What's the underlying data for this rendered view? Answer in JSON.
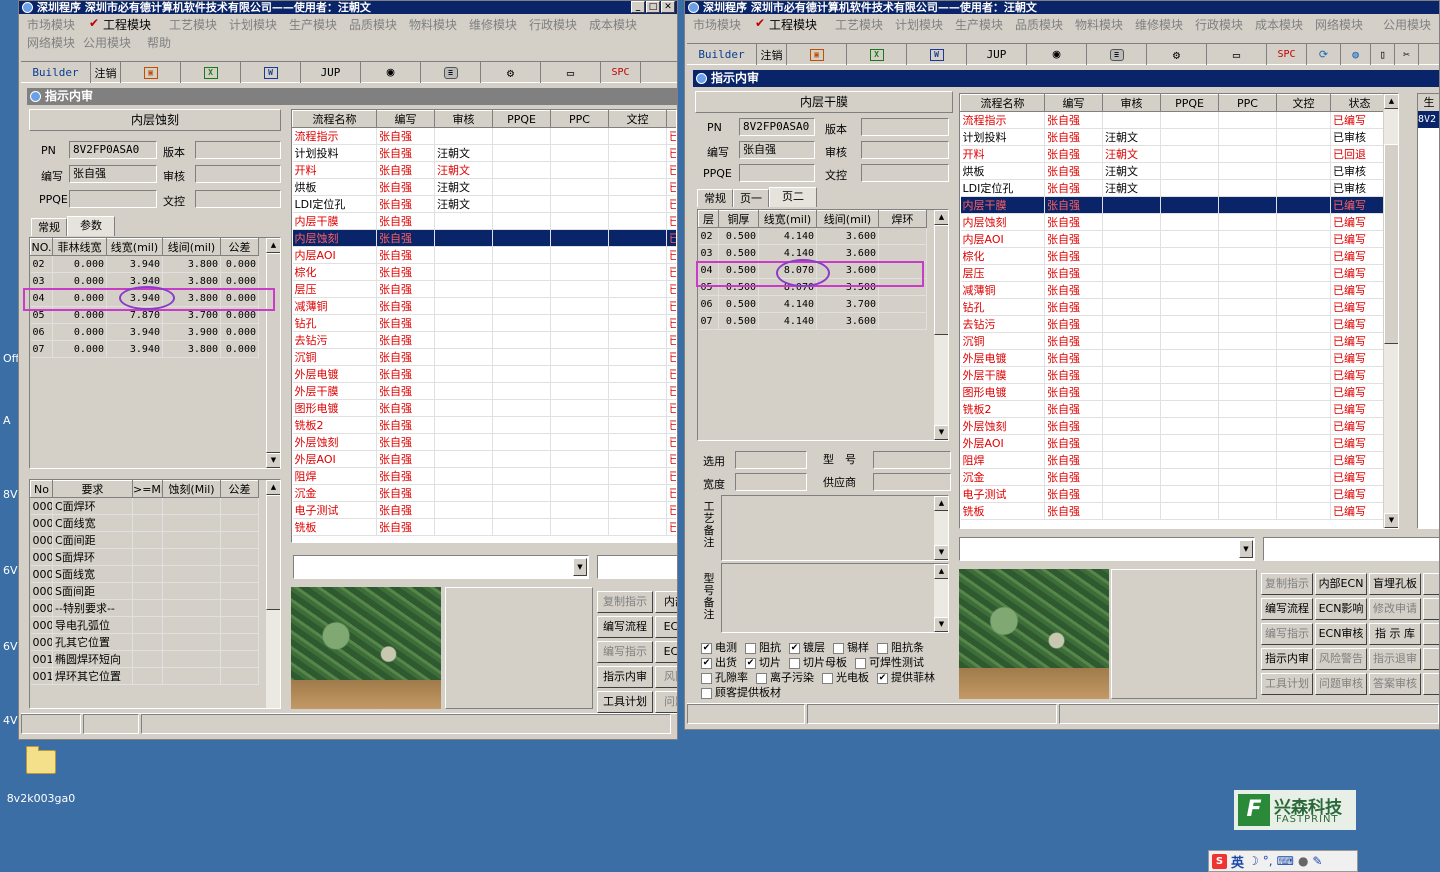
{
  "left_window": {
    "title": "深圳程序    深圳市必有德计算机软件技术有限公司——使用者：汪朝文",
    "menu_row1": [
      "市场模块",
      "工程模块",
      "工艺模块",
      "计划模块",
      "生产模块",
      "品质模块",
      "物料模块",
      "维修模块",
      "行政模块",
      "成本模块"
    ],
    "menu_row2": [
      "网络模块",
      "公用模块",
      "帮助"
    ],
    "toolbar": {
      "builder": "Builder",
      "logout": "注销",
      "jup": "JUP",
      "spc": "SPC"
    },
    "panel_title": "指示内审",
    "process_name": "内层蚀刻",
    "labels": {
      "pn": "PN",
      "version": "版本",
      "author": "编写",
      "review": "审核",
      "ppqe": "PPQE",
      "doc_control": "文控"
    },
    "fields": {
      "pn": "8V2FP0ASA0",
      "author": "张自强"
    },
    "tabs": [
      "常规",
      "参数"
    ],
    "param_headers": [
      "NO.",
      "菲林线宽",
      "线宽(mil)",
      "线间(mil)",
      "公差"
    ],
    "param_rows": [
      [
        "02",
        "0.000",
        "3.940",
        "3.800",
        "0.000"
      ],
      [
        "03",
        "0.000",
        "3.940",
        "3.800",
        "0.000"
      ],
      [
        "04",
        "0.000",
        "3.940",
        "3.800",
        "0.000"
      ],
      [
        "05",
        "0.000",
        "7.870",
        "3.700",
        "0.000"
      ],
      [
        "06",
        "0.000",
        "3.940",
        "3.900",
        "0.000"
      ],
      [
        "07",
        "0.000",
        "3.940",
        "3.800",
        "0.000"
      ]
    ],
    "req_headers": [
      "No",
      "要求",
      ">=Mil",
      "蚀刻(Mil)",
      "公差"
    ],
    "req_rows": [
      [
        "000",
        "C面焊环"
      ],
      [
        "000",
        "C面线宽"
      ],
      [
        "000",
        "C面间距"
      ],
      [
        "000",
        "S面焊环"
      ],
      [
        "000",
        "S面线宽"
      ],
      [
        "000",
        "S面间距"
      ],
      [
        "000",
        "--特别要求--"
      ],
      [
        "000",
        "导电孔弧位"
      ],
      [
        "000",
        "孔其它位置"
      ],
      [
        "001",
        "椭圆焊环短向"
      ],
      [
        "001",
        "焊环其它位置"
      ]
    ],
    "flow_headers": [
      "流程名称",
      "编写",
      "审核",
      "PPQE",
      "PPC",
      "文控"
    ],
    "flow_rows": [
      {
        "name": "流程指示",
        "author": "张自强",
        "review": "",
        "red": true
      },
      {
        "name": "计划投料",
        "author": "张自强",
        "review": "汪朝文",
        "red": false
      },
      {
        "name": "开料",
        "author": "张自强",
        "review": "汪朝文",
        "red": true
      },
      {
        "name": "烘板",
        "author": "张自强",
        "review": "汪朝文",
        "red": false
      },
      {
        "name": "LDI定位孔",
        "author": "张自强",
        "review": "汪朝文",
        "red": false
      },
      {
        "name": "内层干膜",
        "author": "张自强",
        "review": "",
        "red": true
      },
      {
        "name": "内层蚀刻",
        "author": "张自强",
        "review": "",
        "red": true,
        "selected": true
      },
      {
        "name": "内层AOI",
        "author": "张自强",
        "review": "",
        "red": true
      },
      {
        "name": "棕化",
        "author": "张自强",
        "review": "",
        "red": true
      },
      {
        "name": "层压",
        "author": "张自强",
        "review": "",
        "red": true
      },
      {
        "name": "减薄铜",
        "author": "张自强",
        "review": "",
        "red": true
      },
      {
        "name": "钻孔",
        "author": "张自强",
        "review": "",
        "red": true
      },
      {
        "name": "去钻污",
        "author": "张自强",
        "review": "",
        "red": true
      },
      {
        "name": "沉铜",
        "author": "张自强",
        "review": "",
        "red": true
      },
      {
        "name": "外层电镀",
        "author": "张自强",
        "review": "",
        "red": true
      },
      {
        "name": "外层干膜",
        "author": "张自强",
        "review": "",
        "red": true
      },
      {
        "name": "图形电镀",
        "author": "张自强",
        "review": "",
        "red": true
      },
      {
        "name": "铣板2",
        "author": "张自强",
        "review": "",
        "red": true
      },
      {
        "name": "外层蚀刻",
        "author": "张自强",
        "review": "",
        "red": true
      },
      {
        "name": "外层AOI",
        "author": "张自强",
        "review": "",
        "red": true
      },
      {
        "name": "阻焊",
        "author": "张自强",
        "review": "",
        "red": true
      },
      {
        "name": "沉金",
        "author": "张自强",
        "review": "",
        "red": true
      },
      {
        "name": "电子测试",
        "author": "张自强",
        "review": "",
        "red": true
      },
      {
        "name": "铣板",
        "author": "张自强",
        "review": "",
        "red": true
      }
    ],
    "buttons": [
      [
        "复制指示",
        "内部"
      ],
      [
        "编写流程",
        "ECN"
      ],
      [
        "编写指示",
        "ECN"
      ],
      [
        "指示内审",
        "风险"
      ],
      [
        "工具计划",
        "问题"
      ]
    ]
  },
  "right_window": {
    "title": "深圳程序    深圳市必有德计算机软件技术有限公司——使用者：汪朝文",
    "menu_row1": [
      "市场模块",
      "工程模块",
      "工艺模块",
      "计划模块",
      "生产模块",
      "品质模块",
      "物料模块",
      "维修模块",
      "行政模块",
      "成本模块",
      "网络模块",
      "公用模块"
    ],
    "toolbar": {
      "builder": "Builder",
      "logout": "注销",
      "jup": "JUP",
      "spc": "SPC"
    },
    "panel_title": "指示内审",
    "process_name": "内层干膜",
    "labels": {
      "pn": "PN",
      "version": "版本",
      "author": "编写",
      "review": "审核",
      "ppqe": "PPQE",
      "doc_control": "文控"
    },
    "fields": {
      "pn": "8V2FP0ASA0",
      "author": "张自强"
    },
    "tabs": [
      "常规",
      "页一",
      "页二"
    ],
    "param_headers": [
      "层",
      "铜厚",
      "线宽(mil)",
      "线间(mil)",
      "焊环"
    ],
    "param_rows": [
      [
        "02",
        "0.500",
        "4.140",
        "3.600",
        ""
      ],
      [
        "03",
        "0.500",
        "4.140",
        "3.600",
        ""
      ],
      [
        "04",
        "0.500",
        "8.070",
        "3.600",
        ""
      ],
      [
        "05",
        "0.500",
        "8.070",
        "3.500",
        ""
      ],
      [
        "06",
        "0.500",
        "4.140",
        "3.700",
        ""
      ],
      [
        "07",
        "0.500",
        "4.140",
        "3.600",
        ""
      ]
    ],
    "labels2": {
      "choose": "选用",
      "model": "型　号",
      "width": "宽度",
      "supplier": "供应商",
      "process_note": "工艺备注",
      "model_note": "型号备注"
    },
    "checkboxes": [
      {
        "label": "电测",
        "checked": true
      },
      {
        "label": "阻抗",
        "checked": false
      },
      {
        "label": "镀层",
        "checked": true
      },
      {
        "label": "锡样",
        "checked": false
      },
      {
        "label": "阻抗条",
        "checked": false
      },
      {
        "label": "出货",
        "checked": true
      },
      {
        "label": "切片",
        "checked": true
      },
      {
        "label": "切片母板",
        "checked": false
      },
      {
        "label": "可焊性测试",
        "checked": false
      },
      {
        "label": "孔隙率",
        "checked": false
      },
      {
        "label": "离子污染",
        "checked": false
      },
      {
        "label": "光电板",
        "checked": false
      },
      {
        "label": "提供菲林",
        "checked": true
      },
      {
        "label": "顾客提供板材",
        "checked": false
      }
    ],
    "flow_headers": [
      "流程名称",
      "编写",
      "审核",
      "PPQE",
      "PPC",
      "文控",
      "状态"
    ],
    "flow_rows": [
      {
        "name": "流程指示",
        "author": "张自强",
        "review": "",
        "status": "已编写",
        "red": true,
        "status_red": true
      },
      {
        "name": "计划投料",
        "author": "张自强",
        "review": "汪朝文",
        "status": "已审核",
        "red": false,
        "status_red": false
      },
      {
        "name": "开料",
        "author": "张自强",
        "review": "汪朝文",
        "status": "已回退",
        "red": true,
        "status_red": true
      },
      {
        "name": "烘板",
        "author": "张自强",
        "review": "汪朝文",
        "status": "已审核",
        "red": false,
        "status_red": false
      },
      {
        "name": "LDI定位孔",
        "author": "张自强",
        "review": "汪朝文",
        "status": "已审核",
        "red": false,
        "status_red": false
      },
      {
        "name": "内层干膜",
        "author": "张自强",
        "review": "",
        "status": "已编写",
        "red": true,
        "status_red": true,
        "selected": true
      },
      {
        "name": "内层蚀刻",
        "author": "张自强",
        "review": "",
        "status": "已编写",
        "red": true,
        "status_red": true
      },
      {
        "name": "内层AOI",
        "author": "张自强",
        "review": "",
        "status": "已编写",
        "red": true,
        "status_red": true
      },
      {
        "name": "棕化",
        "author": "张自强",
        "review": "",
        "status": "已编写",
        "red": true,
        "status_red": true
      },
      {
        "name": "层压",
        "author": "张自强",
        "review": "",
        "status": "已编写",
        "red": true,
        "status_red": true
      },
      {
        "name": "减薄铜",
        "author": "张自强",
        "review": "",
        "status": "已编写",
        "red": true,
        "status_red": true
      },
      {
        "name": "钻孔",
        "author": "张自强",
        "review": "",
        "status": "已编写",
        "red": true,
        "status_red": true
      },
      {
        "name": "去钻污",
        "author": "张自强",
        "review": "",
        "status": "已编写",
        "red": true,
        "status_red": true
      },
      {
        "name": "沉铜",
        "author": "张自强",
        "review": "",
        "status": "已编写",
        "red": true,
        "status_red": true
      },
      {
        "name": "外层电镀",
        "author": "张自强",
        "review": "",
        "status": "已编写",
        "red": true,
        "status_red": true
      },
      {
        "name": "外层干膜",
        "author": "张自强",
        "review": "",
        "status": "已编写",
        "red": true,
        "status_red": true
      },
      {
        "name": "图形电镀",
        "author": "张自强",
        "review": "",
        "status": "已编写",
        "red": true,
        "status_red": true
      },
      {
        "name": "铣板2",
        "author": "张自强",
        "review": "",
        "status": "已编写",
        "red": true,
        "status_red": true
      },
      {
        "name": "外层蚀刻",
        "author": "张自强",
        "review": "",
        "status": "已编写",
        "red": true,
        "status_red": true
      },
      {
        "name": "外层AOI",
        "author": "张自强",
        "review": "",
        "status": "已编写",
        "red": true,
        "status_red": true
      },
      {
        "name": "阻焊",
        "author": "张自强",
        "review": "",
        "status": "已编写",
        "red": true,
        "status_red": true
      },
      {
        "name": "沉金",
        "author": "张自强",
        "review": "",
        "status": "已编写",
        "red": true,
        "status_red": true
      },
      {
        "name": "电子测试",
        "author": "张自强",
        "review": "",
        "status": "已编写",
        "red": true,
        "status_red": true
      },
      {
        "name": "铣板",
        "author": "张自强",
        "review": "",
        "status": "已编写",
        "red": true,
        "status_red": true
      }
    ],
    "side_header": "生",
    "side_value": "8V2",
    "buttons": [
      [
        "复制指示",
        "内部ECN",
        "盲埋孔板"
      ],
      [
        "编写流程",
        "ECN影响",
        "修改申请"
      ],
      [
        "编写指示",
        "ECN审核",
        "指 示 库"
      ],
      [
        "指示内审",
        "风险警告",
        "指示退审"
      ],
      [
        "工具计划",
        "问题审核",
        "答案审核"
      ]
    ],
    "buttons_disabled": [
      [
        true,
        false,
        false
      ],
      [
        false,
        false,
        true
      ],
      [
        true,
        false,
        false
      ],
      [
        false,
        true,
        true
      ],
      [
        true,
        true,
        true
      ]
    ]
  },
  "desktop": {
    "folder_label": "8v2k003ga0",
    "logo_cn": "兴森科技",
    "logo_en": "FASTPRINT",
    "ime_text": "英",
    "edge_labels": [
      "Off",
      "A",
      "8V",
      "6V",
      "6V",
      "4V"
    ]
  }
}
